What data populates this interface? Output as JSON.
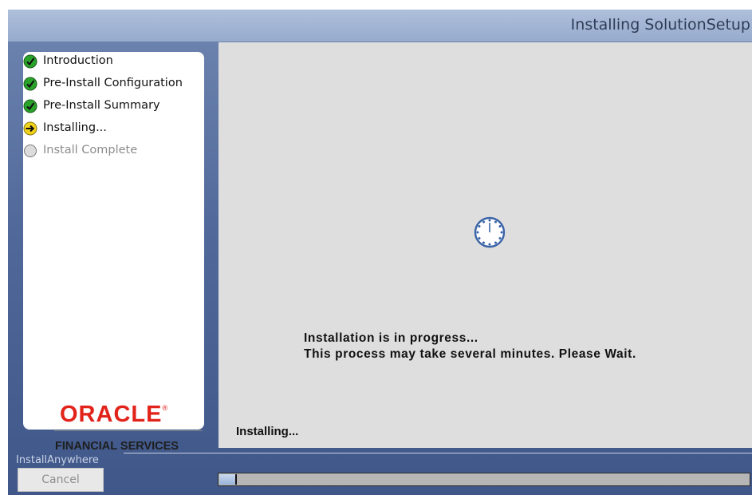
{
  "window": {
    "title": "Installing SolutionSetup"
  },
  "steps": [
    {
      "label": "Introduction",
      "status": "complete",
      "icon": "check-icon"
    },
    {
      "label": "Pre-Install Configuration",
      "status": "complete",
      "icon": "check-icon"
    },
    {
      "label": "Pre-Install Summary",
      "status": "complete",
      "icon": "check-icon"
    },
    {
      "label": "Installing...",
      "status": "current",
      "icon": "arrow-right-icon"
    },
    {
      "label": "Install Complete",
      "status": "pending",
      "icon": "circle-icon"
    }
  ],
  "branding": {
    "logo": "ORACLE",
    "subtitle": "FINANCIAL SERVICES"
  },
  "content": {
    "message_line1": "Installation is in progress...",
    "message_line2": "This process may take several minutes. Please Wait.",
    "status": "Installing..."
  },
  "footer": {
    "installer_label": "InstallAnywhere",
    "cancel_label": "Cancel",
    "progress_fraction": 0.03
  },
  "colors": {
    "complete": "#2aa32a",
    "current": "#f2d31c",
    "pending": "#cfcfcf",
    "brand_red": "#e2231a"
  }
}
